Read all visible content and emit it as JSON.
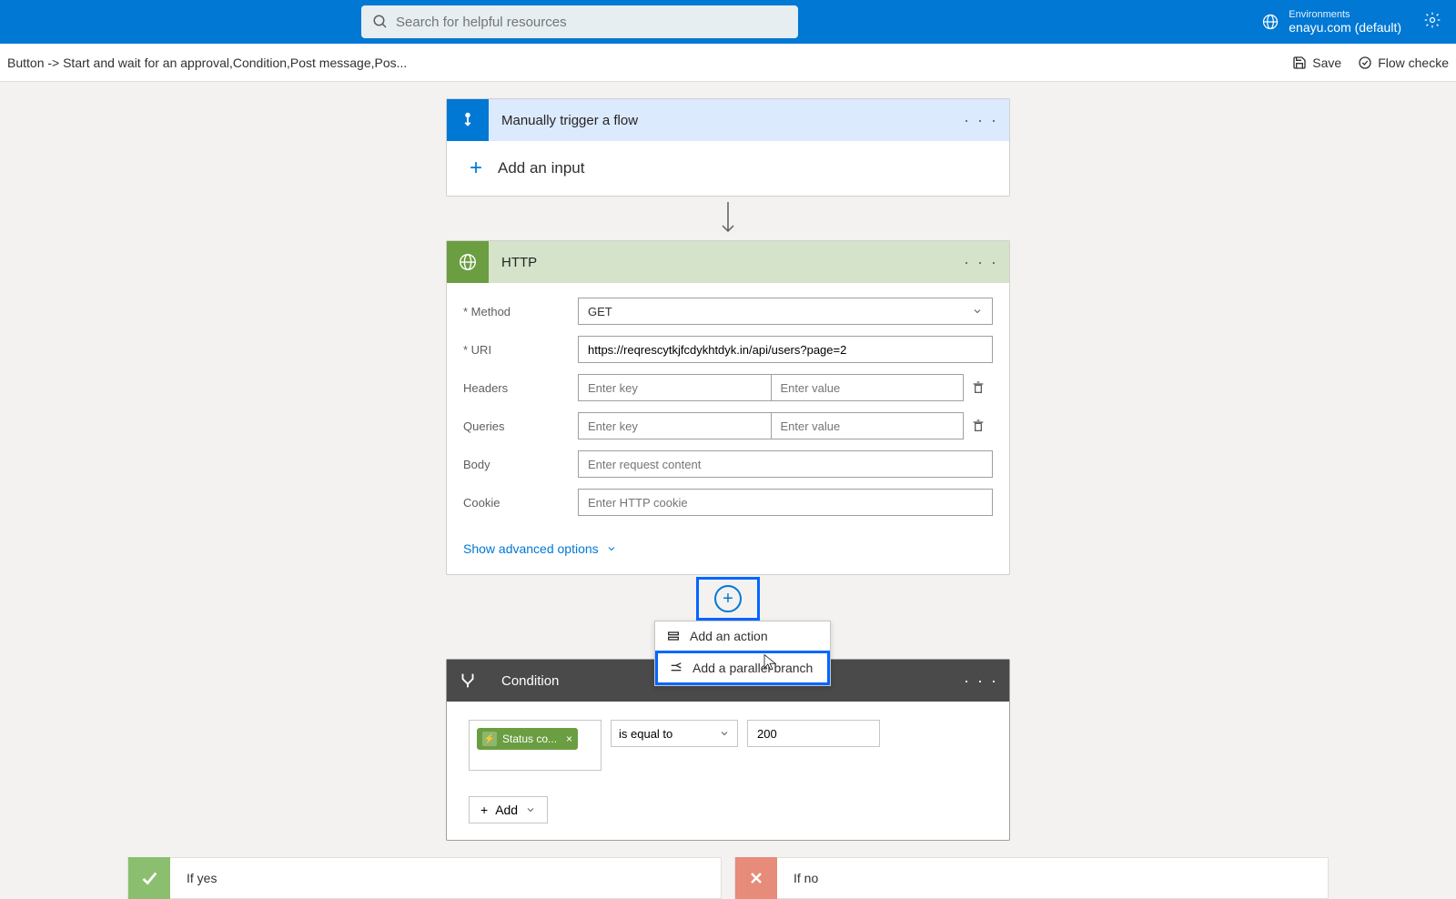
{
  "search": {
    "placeholder": "Search for helpful resources"
  },
  "env": {
    "label": "Environments",
    "value": "enayu.com (default)"
  },
  "secbar": {
    "breadcrumb": "Button -> Start and wait for an approval,Condition,Post message,Pos...",
    "save": "Save",
    "checker": "Flow checke"
  },
  "trigger": {
    "title": "Manually trigger a flow",
    "add_input": "Add an input"
  },
  "http": {
    "title": "HTTP",
    "labels": {
      "method": "Method",
      "uri": "URI",
      "headers": "Headers",
      "queries": "Queries",
      "body": "Body",
      "cookie": "Cookie"
    },
    "method": "GET",
    "uri": "https://reqrescytkjfcdykhtdyk.in/api/users?page=2",
    "placeholders": {
      "key": "Enter key",
      "value": "Enter value",
      "body": "Enter request content",
      "cookie": "Enter HTTP cookie"
    },
    "advanced": "Show advanced options"
  },
  "popup": {
    "add_action": "Add an action",
    "add_parallel": "Add a parallel branch"
  },
  "condition": {
    "title": "Condition",
    "token": "Status co...",
    "operator": "is equal to",
    "value": "200",
    "add": "Add"
  },
  "branches": {
    "yes": "If yes",
    "no": "If no"
  }
}
